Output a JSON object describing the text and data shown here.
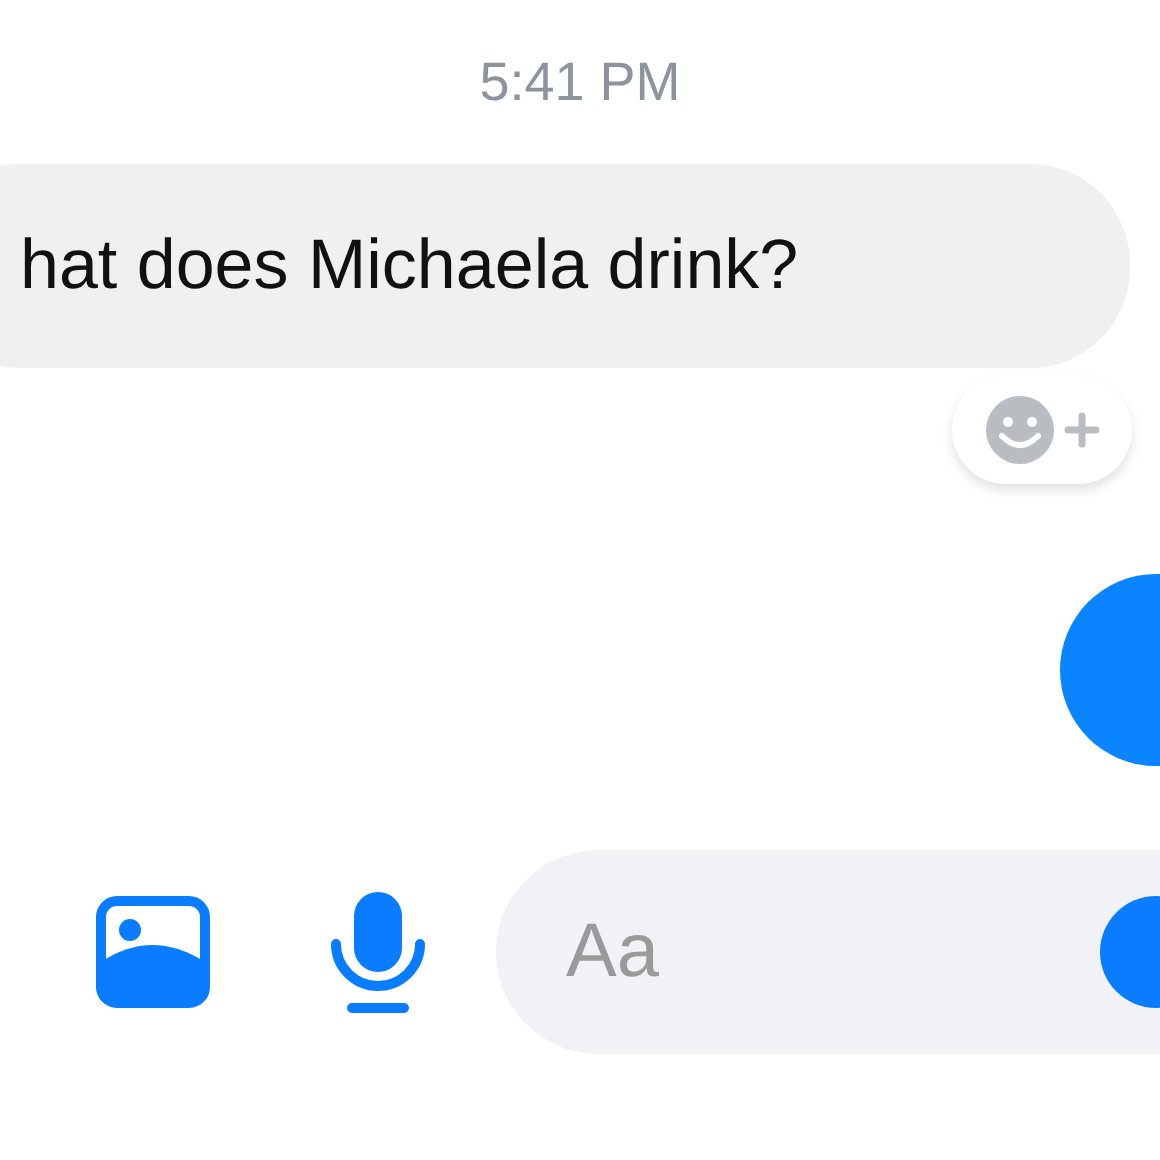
{
  "timestamp": "5:41 PM",
  "message": {
    "text": "hat does Michaela drink?"
  },
  "composer": {
    "placeholder": "Aa"
  }
}
